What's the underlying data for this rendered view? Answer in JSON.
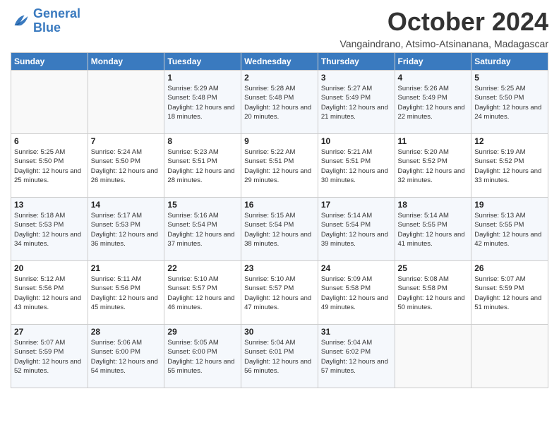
{
  "logo": {
    "line1": "General",
    "line2": "Blue"
  },
  "title": "October 2024",
  "subtitle": "Vangaindrano, Atsimo-Atsinanana, Madagascar",
  "days_header": [
    "Sunday",
    "Monday",
    "Tuesday",
    "Wednesday",
    "Thursday",
    "Friday",
    "Saturday"
  ],
  "weeks": [
    [
      {
        "day": "",
        "sunrise": "",
        "sunset": "",
        "daylight": ""
      },
      {
        "day": "",
        "sunrise": "",
        "sunset": "",
        "daylight": ""
      },
      {
        "day": "1",
        "sunrise": "Sunrise: 5:29 AM",
        "sunset": "Sunset: 5:48 PM",
        "daylight": "Daylight: 12 hours and 18 minutes."
      },
      {
        "day": "2",
        "sunrise": "Sunrise: 5:28 AM",
        "sunset": "Sunset: 5:48 PM",
        "daylight": "Daylight: 12 hours and 20 minutes."
      },
      {
        "day": "3",
        "sunrise": "Sunrise: 5:27 AM",
        "sunset": "Sunset: 5:49 PM",
        "daylight": "Daylight: 12 hours and 21 minutes."
      },
      {
        "day": "4",
        "sunrise": "Sunrise: 5:26 AM",
        "sunset": "Sunset: 5:49 PM",
        "daylight": "Daylight: 12 hours and 22 minutes."
      },
      {
        "day": "5",
        "sunrise": "Sunrise: 5:25 AM",
        "sunset": "Sunset: 5:50 PM",
        "daylight": "Daylight: 12 hours and 24 minutes."
      }
    ],
    [
      {
        "day": "6",
        "sunrise": "Sunrise: 5:25 AM",
        "sunset": "Sunset: 5:50 PM",
        "daylight": "Daylight: 12 hours and 25 minutes."
      },
      {
        "day": "7",
        "sunrise": "Sunrise: 5:24 AM",
        "sunset": "Sunset: 5:50 PM",
        "daylight": "Daylight: 12 hours and 26 minutes."
      },
      {
        "day": "8",
        "sunrise": "Sunrise: 5:23 AM",
        "sunset": "Sunset: 5:51 PM",
        "daylight": "Daylight: 12 hours and 28 minutes."
      },
      {
        "day": "9",
        "sunrise": "Sunrise: 5:22 AM",
        "sunset": "Sunset: 5:51 PM",
        "daylight": "Daylight: 12 hours and 29 minutes."
      },
      {
        "day": "10",
        "sunrise": "Sunrise: 5:21 AM",
        "sunset": "Sunset: 5:51 PM",
        "daylight": "Daylight: 12 hours and 30 minutes."
      },
      {
        "day": "11",
        "sunrise": "Sunrise: 5:20 AM",
        "sunset": "Sunset: 5:52 PM",
        "daylight": "Daylight: 12 hours and 32 minutes."
      },
      {
        "day": "12",
        "sunrise": "Sunrise: 5:19 AM",
        "sunset": "Sunset: 5:52 PM",
        "daylight": "Daylight: 12 hours and 33 minutes."
      }
    ],
    [
      {
        "day": "13",
        "sunrise": "Sunrise: 5:18 AM",
        "sunset": "Sunset: 5:53 PM",
        "daylight": "Daylight: 12 hours and 34 minutes."
      },
      {
        "day": "14",
        "sunrise": "Sunrise: 5:17 AM",
        "sunset": "Sunset: 5:53 PM",
        "daylight": "Daylight: 12 hours and 36 minutes."
      },
      {
        "day": "15",
        "sunrise": "Sunrise: 5:16 AM",
        "sunset": "Sunset: 5:54 PM",
        "daylight": "Daylight: 12 hours and 37 minutes."
      },
      {
        "day": "16",
        "sunrise": "Sunrise: 5:15 AM",
        "sunset": "Sunset: 5:54 PM",
        "daylight": "Daylight: 12 hours and 38 minutes."
      },
      {
        "day": "17",
        "sunrise": "Sunrise: 5:14 AM",
        "sunset": "Sunset: 5:54 PM",
        "daylight": "Daylight: 12 hours and 39 minutes."
      },
      {
        "day": "18",
        "sunrise": "Sunrise: 5:14 AM",
        "sunset": "Sunset: 5:55 PM",
        "daylight": "Daylight: 12 hours and 41 minutes."
      },
      {
        "day": "19",
        "sunrise": "Sunrise: 5:13 AM",
        "sunset": "Sunset: 5:55 PM",
        "daylight": "Daylight: 12 hours and 42 minutes."
      }
    ],
    [
      {
        "day": "20",
        "sunrise": "Sunrise: 5:12 AM",
        "sunset": "Sunset: 5:56 PM",
        "daylight": "Daylight: 12 hours and 43 minutes."
      },
      {
        "day": "21",
        "sunrise": "Sunrise: 5:11 AM",
        "sunset": "Sunset: 5:56 PM",
        "daylight": "Daylight: 12 hours and 45 minutes."
      },
      {
        "day": "22",
        "sunrise": "Sunrise: 5:10 AM",
        "sunset": "Sunset: 5:57 PM",
        "daylight": "Daylight: 12 hours and 46 minutes."
      },
      {
        "day": "23",
        "sunrise": "Sunrise: 5:10 AM",
        "sunset": "Sunset: 5:57 PM",
        "daylight": "Daylight: 12 hours and 47 minutes."
      },
      {
        "day": "24",
        "sunrise": "Sunrise: 5:09 AM",
        "sunset": "Sunset: 5:58 PM",
        "daylight": "Daylight: 12 hours and 49 minutes."
      },
      {
        "day": "25",
        "sunrise": "Sunrise: 5:08 AM",
        "sunset": "Sunset: 5:58 PM",
        "daylight": "Daylight: 12 hours and 50 minutes."
      },
      {
        "day": "26",
        "sunrise": "Sunrise: 5:07 AM",
        "sunset": "Sunset: 5:59 PM",
        "daylight": "Daylight: 12 hours and 51 minutes."
      }
    ],
    [
      {
        "day": "27",
        "sunrise": "Sunrise: 5:07 AM",
        "sunset": "Sunset: 5:59 PM",
        "daylight": "Daylight: 12 hours and 52 minutes."
      },
      {
        "day": "28",
        "sunrise": "Sunrise: 5:06 AM",
        "sunset": "Sunset: 6:00 PM",
        "daylight": "Daylight: 12 hours and 54 minutes."
      },
      {
        "day": "29",
        "sunrise": "Sunrise: 5:05 AM",
        "sunset": "Sunset: 6:00 PM",
        "daylight": "Daylight: 12 hours and 55 minutes."
      },
      {
        "day": "30",
        "sunrise": "Sunrise: 5:04 AM",
        "sunset": "Sunset: 6:01 PM",
        "daylight": "Daylight: 12 hours and 56 minutes."
      },
      {
        "day": "31",
        "sunrise": "Sunrise: 5:04 AM",
        "sunset": "Sunset: 6:02 PM",
        "daylight": "Daylight: 12 hours and 57 minutes."
      },
      {
        "day": "",
        "sunrise": "",
        "sunset": "",
        "daylight": ""
      },
      {
        "day": "",
        "sunrise": "",
        "sunset": "",
        "daylight": ""
      }
    ]
  ]
}
